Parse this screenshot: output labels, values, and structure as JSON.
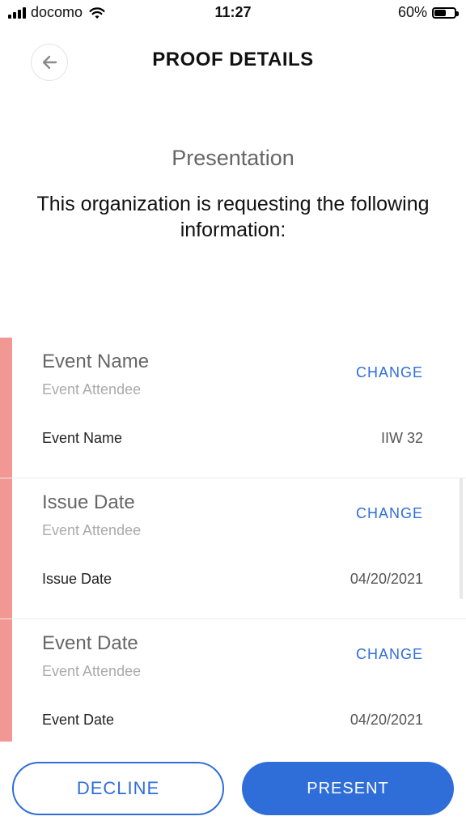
{
  "status_bar": {
    "carrier": "docomo",
    "time": "11:27",
    "battery_text": "60%",
    "battery_level": 0.6,
    "icons": [
      "signal-icon",
      "wifi-icon",
      "battery-icon"
    ]
  },
  "header": {
    "title": "PROOF DETAILS",
    "back_icon": "arrow-left-icon"
  },
  "intro": {
    "subtitle": "Presentation",
    "request_text": "This organization is requesting the following information:"
  },
  "cards": [
    {
      "title": "Event Name",
      "subtitle": "Event Attendee",
      "change_label": "CHANGE",
      "field_label": "Event Name",
      "field_value": "IIW 32"
    },
    {
      "title": "Issue Date",
      "subtitle": "Event Attendee",
      "change_label": "CHANGE",
      "field_label": "Issue Date",
      "field_value": "04/20/2021"
    },
    {
      "title": "Event Date",
      "subtitle": "Event Attendee",
      "change_label": "CHANGE",
      "field_label": "Event Date",
      "field_value": "04/20/2021"
    }
  ],
  "actions": {
    "decline_label": "DECLINE",
    "present_label": "PRESENT"
  },
  "colors": {
    "accent": "#2f6ed8",
    "card_bar": "#f19894"
  }
}
